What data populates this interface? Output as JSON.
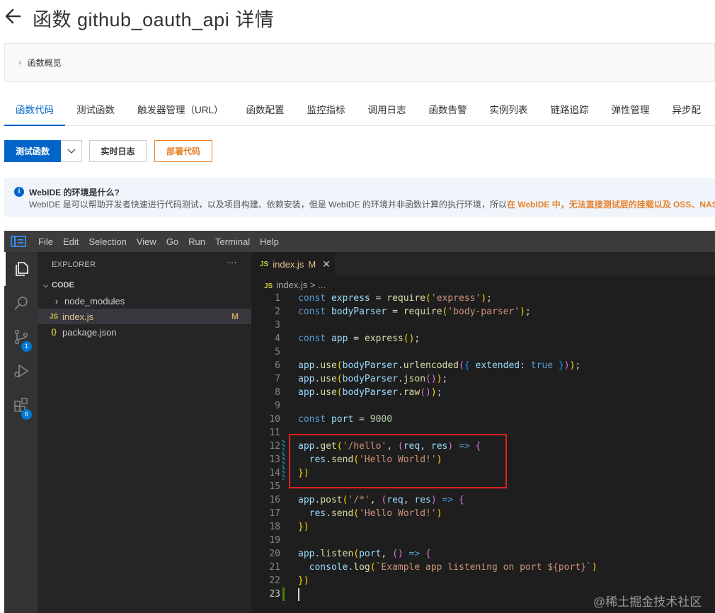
{
  "header": {
    "title": "函数 github_oauth_api 详情"
  },
  "overview": {
    "label": "函数概览"
  },
  "tabs": [
    {
      "label": "函数代码",
      "active": true
    },
    {
      "label": "测试函数"
    },
    {
      "label": "触发器管理（URL）"
    },
    {
      "label": "函数配置"
    },
    {
      "label": "监控指标"
    },
    {
      "label": "调用日志"
    },
    {
      "label": "函数告警"
    },
    {
      "label": "实例列表"
    },
    {
      "label": "链路追踪"
    },
    {
      "label": "弹性管理"
    },
    {
      "label": "异步配"
    }
  ],
  "actions": {
    "test_label": "测试函数",
    "logs_label": "实时日志",
    "deploy_label": "部署代码"
  },
  "info": {
    "title": "WebIDE 的环境是什么?",
    "text_plain": "WebIDE 是可以帮助开发者快速进行代码测试，以及项目构建、依赖安装，但是 WebIDE 的环境并非函数计算的执行环境，所以",
    "text_highlight": "在 WebIDE 中，无法直接测试层的挂载以及 OSS、NAS 以"
  },
  "ide": {
    "menu": [
      "File",
      "Edit",
      "Selection",
      "View",
      "Go",
      "Run",
      "Terminal",
      "Help"
    ],
    "activity_badges": {
      "source_control": "1",
      "extensions": "6"
    },
    "explorer": {
      "header": "EXPLORER",
      "more": "···",
      "section": "CODE",
      "items": [
        {
          "name": "node_modules",
          "icon": "chevron-right-icon"
        },
        {
          "name": "index.js",
          "icon": "js-file-icon",
          "status": "M",
          "selected": true
        },
        {
          "name": "package.json",
          "icon": "json-file-icon"
        }
      ]
    },
    "editor": {
      "tab_name": "index.js",
      "tab_status": "M",
      "breadcrumb_file": "index.js",
      "breadcrumb_sep": ">",
      "breadcrumb_more": "...",
      "file_icon_label": "JS",
      "json_icon_label": "{}",
      "current_line": 23,
      "lines": [
        "const express = require('express');",
        "const bodyParser = require('body-parser');",
        "",
        "const app = express();",
        "",
        "app.use(bodyParser.urlencoded({ extended: true }));",
        "app.use(bodyParser.json());",
        "app.use(bodyParser.raw());",
        "",
        "const port = 9000",
        "",
        "app.get('/hello', (req, res) => {",
        "  res.send('Hello World!')",
        "})",
        "",
        "app.post('/*', (req, res) => {",
        "  res.send('Hello World!')",
        "})",
        "",
        "app.listen(port, () => {",
        "  console.log(`Example app listening on port ${port}`)",
        "})",
        ""
      ]
    }
  },
  "watermark": "@稀土掘金技术社区"
}
